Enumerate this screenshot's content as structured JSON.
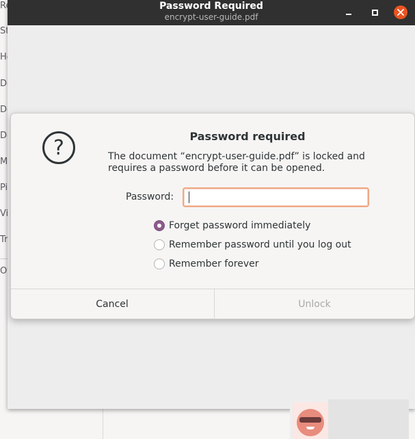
{
  "window": {
    "title": "Password Required",
    "subtitle": "encrypt-user-guide.pdf",
    "minimize_icon": "minimize-icon",
    "maximize_icon": "maximize-icon",
    "close_icon": "close-icon",
    "close_color": "#e95420"
  },
  "background_sidebar": {
    "items": [
      "Re",
      "St",
      "Ho",
      "De",
      "Do",
      "Do",
      "Mu",
      "Pi",
      "Vi",
      "Tr",
      "Ot"
    ]
  },
  "dialog": {
    "icon": "question-icon",
    "icon_glyph": "?",
    "title": "Password required",
    "message": "The document “encrypt-user-guide.pdf” is locked and requires a password before it can be opened.",
    "password_label": "Password:",
    "password_value": "",
    "options": [
      {
        "label": "Forget password immediately",
        "checked": true
      },
      {
        "label": "Remember password until you log out",
        "checked": false
      },
      {
        "label": "Remember forever",
        "checked": false
      }
    ],
    "cancel_label": "Cancel",
    "unlock_label": "Unlock",
    "accent_color": "#8c5b8c"
  }
}
